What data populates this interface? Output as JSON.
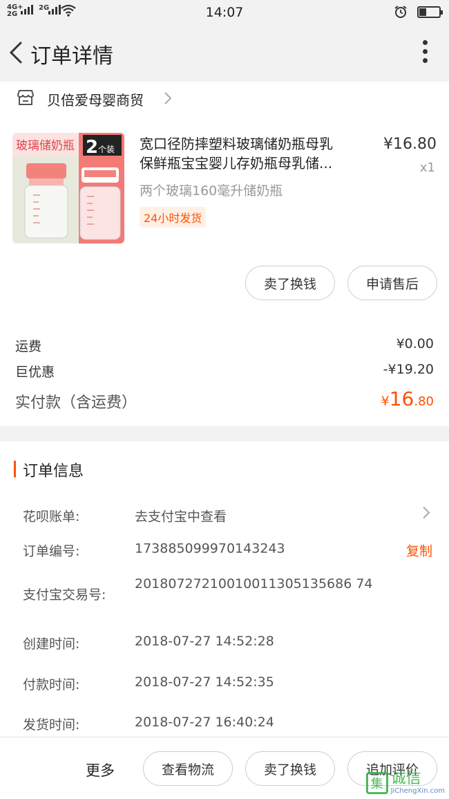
{
  "statusbar": {
    "signal1": "4G+\n2G",
    "signal2": "2G",
    "time": "14:07",
    "battery_level": 0.35,
    "icons": [
      "wifi-icon",
      "alarm-icon",
      "battery-icon"
    ]
  },
  "nav": {
    "title": "订单详情",
    "icons": [
      "back-icon",
      "more-vertical-icon"
    ]
  },
  "shop": {
    "name": "贝倍爱母婴商贸",
    "icon": "store-icon"
  },
  "product": {
    "title_line1": "宽口径防摔塑料玻璃储奶瓶母乳",
    "title_line2": "保鲜瓶宝宝婴儿存奶瓶母乳储...",
    "price": "¥16.80",
    "qty": "x1",
    "sku": "两个玻璃160毫升储奶瓶",
    "tag": "24小时发货",
    "image": {
      "banner": "玻璃储奶瓶",
      "badge_num": "2",
      "badge_unit": "个装",
      "bg_color": "#e7e9dc",
      "accent": "#f27a77"
    }
  },
  "order_actions": {
    "sell": "卖了换钱",
    "after_sale": "申请售后"
  },
  "fees": {
    "shipping_label": "运费",
    "shipping_value": "¥0.00",
    "discount_label": "巨优惠",
    "discount_value": "-¥19.20",
    "total_label": "实付款（含运费）",
    "total_cur": "¥",
    "total_int": "16",
    "total_dec": ".80"
  },
  "order_info": {
    "section_title": "订单信息",
    "rows": [
      {
        "label": "花呗账单:",
        "value": "去支付宝中查看"
      },
      {
        "label": "订单编号:",
        "value": "173885099970143243"
      },
      {
        "label": "支付宝交易号:",
        "value": "20180727210010011305135686 74"
      },
      {
        "label": "创建时间:",
        "value": "2018-07-27 14:52:28"
      },
      {
        "label": "付款时间:",
        "value": "2018-07-27 14:52:35"
      },
      {
        "label": "发货时间:",
        "value": "2018-07-27 16:40:24"
      }
    ],
    "copy": "复制"
  },
  "bottom": {
    "more": "更多",
    "logistics": "查看物流",
    "sell": "卖了换钱",
    "review": "追加评价"
  },
  "watermark": {
    "zh": "诚信",
    "mark": "集",
    "en": "JiChengXin.com"
  },
  "colors": {
    "accent": "#ff5000",
    "bg": "#f2f2f2"
  }
}
